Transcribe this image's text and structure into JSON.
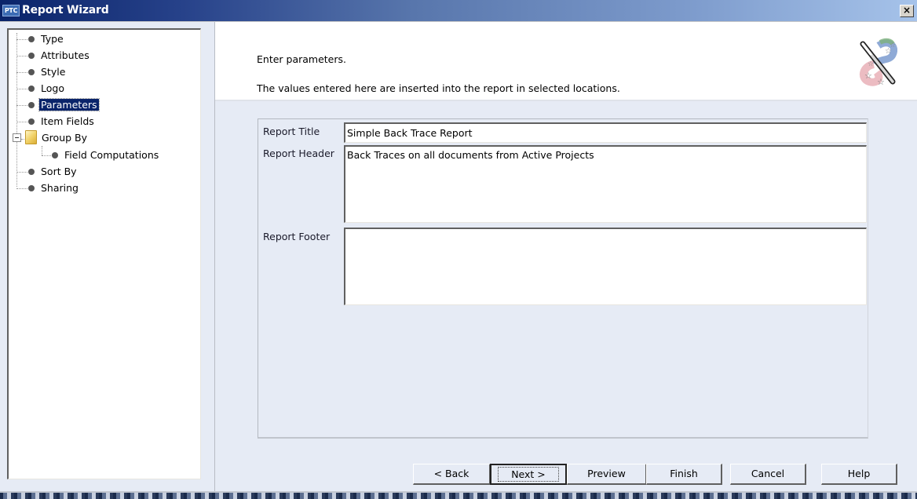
{
  "window": {
    "app_logo": "PTC",
    "title": "Report Wizard",
    "close_label": "×"
  },
  "tree": {
    "items": [
      {
        "label": "Type",
        "selected": false
      },
      {
        "label": "Attributes",
        "selected": false
      },
      {
        "label": "Style",
        "selected": false
      },
      {
        "label": "Logo",
        "selected": false
      },
      {
        "label": "Parameters",
        "selected": true
      },
      {
        "label": "Item Fields",
        "selected": false
      },
      {
        "label": "Group By",
        "selected": false,
        "expanded": true,
        "icon": "folder-icon",
        "children": [
          {
            "label": "Field Computations",
            "selected": false
          }
        ]
      },
      {
        "label": "Sort By",
        "selected": false
      },
      {
        "label": "Sharing",
        "selected": false
      }
    ]
  },
  "header": {
    "line1": "Enter parameters.",
    "line2": "The values entered here are inserted into the report in selected locations.",
    "icon": "magic-wand-icon"
  },
  "form": {
    "report_title": {
      "label": "Report Title",
      "value": "Simple Back Trace Report"
    },
    "report_header": {
      "label": "Report Header",
      "value": "Back Traces on all documents from Active Projects"
    },
    "report_footer": {
      "label": "Report Footer",
      "value": ""
    }
  },
  "buttons": {
    "back": "< Back",
    "next": "Next >",
    "preview": "Preview",
    "finish": "Finish",
    "cancel": "Cancel",
    "help": "Help"
  },
  "colors": {
    "titlebar_start": "#0a246a",
    "titlebar_end": "#a6c3ea",
    "selection": "#0a246a",
    "panel_bg": "#e6ebf5"
  }
}
